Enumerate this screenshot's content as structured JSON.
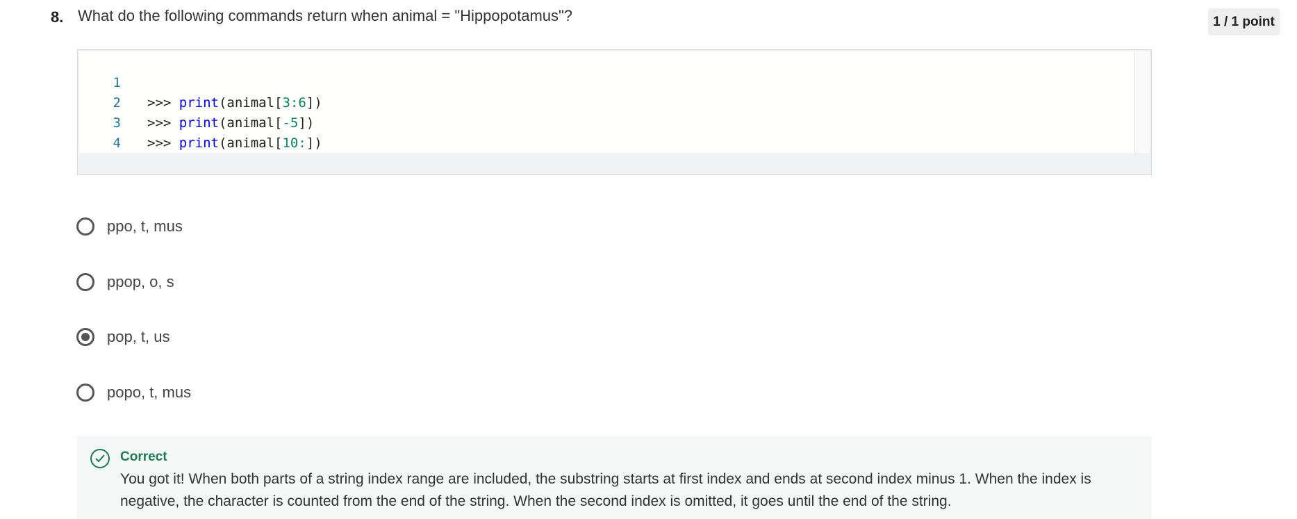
{
  "question": {
    "number": "8.",
    "text": "What do the following commands return when animal = \"Hippopotamus\"?",
    "points": "1 / 1 point"
  },
  "code": {
    "lines": [
      {
        "number": "1",
        "prompt": ">>> ",
        "func": "print",
        "open": "(animal[",
        "arg": "3:6",
        "close": "])"
      },
      {
        "number": "2",
        "prompt": ">>> ",
        "func": "print",
        "open": "(animal[",
        "arg": "-5",
        "close": "])"
      },
      {
        "number": "3",
        "prompt": ">>> ",
        "func": "print",
        "open": "(animal[",
        "arg": "10:",
        "close": "])"
      },
      {
        "number": "4"
      }
    ]
  },
  "options": [
    {
      "label": "ppo, t, mus",
      "selected": false
    },
    {
      "label": "ppop, o, s",
      "selected": false
    },
    {
      "label": "pop, t, us",
      "selected": true
    },
    {
      "label": "popo, t, mus",
      "selected": false
    }
  ],
  "feedback": {
    "status": "Correct",
    "icon": "check-circle-icon",
    "text": "You got it! When both parts of a string index range are included, the substring starts at first index and ends at second index minus 1. When the index is negative, the character is counted from the end of the string. When the second index is omitted, it goes until the end of the string.",
    "color": "#1e7b50"
  }
}
